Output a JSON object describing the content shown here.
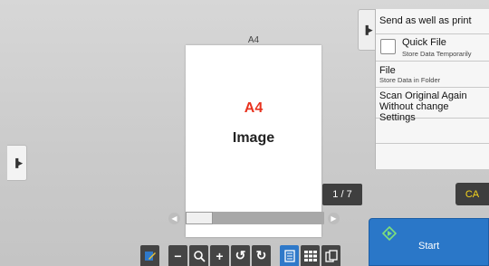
{
  "preview": {
    "paper_size_label": "A4",
    "page_text_size": "A4",
    "page_text_image": "Image",
    "page_counter": "1 / 7",
    "scroll_position": 0.0
  },
  "right_panel": {
    "send_and_print": "Send as well as print",
    "quick_file": {
      "title": "Quick File",
      "subtitle": "Store Data Temporarily",
      "checked": false
    },
    "file": {
      "title": "File",
      "subtitle": "Store Data in Folder"
    },
    "scan_again": {
      "line1": "Scan Original Again",
      "line2": "Without change Settings"
    }
  },
  "buttons": {
    "ca": "CA",
    "start": "Start"
  },
  "toolbar_icons": [
    "edit-icon",
    "zoom-out-icon",
    "magnifier-icon",
    "zoom-in-icon",
    "rotate-left-icon",
    "rotate-right-icon",
    "single-page-view-icon",
    "thumbnail-grid-icon",
    "multi-page-view-icon"
  ],
  "colors": {
    "accent_blue": "#2a77c8",
    "ca_text": "#f7d51c",
    "preview_size_red": "#e8331f"
  }
}
